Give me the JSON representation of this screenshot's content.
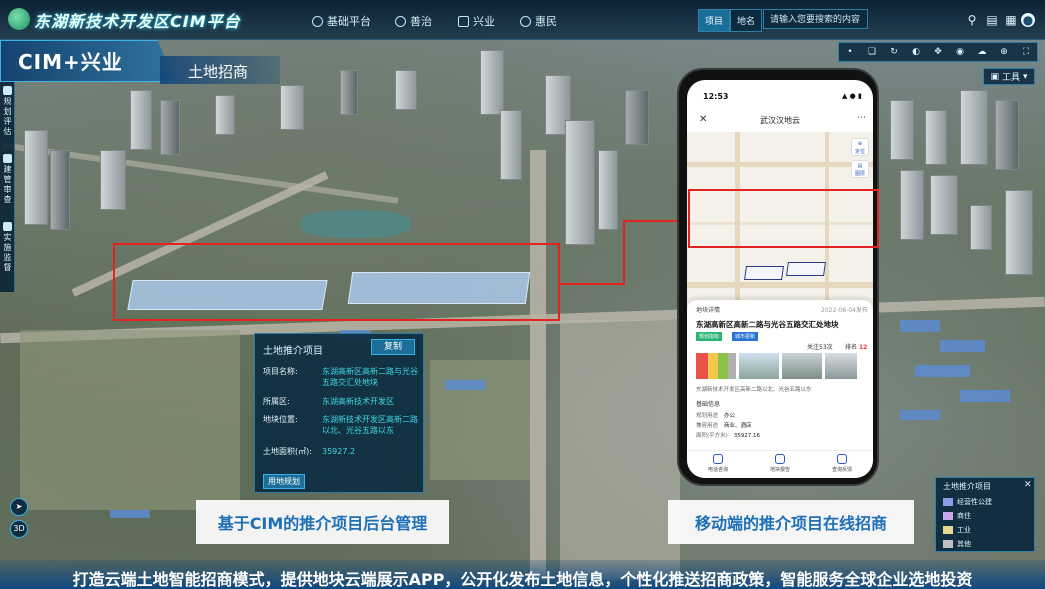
{
  "header": {
    "app_title": "东湖新技术开发区CIM平台",
    "nav": [
      {
        "label": "基础平台"
      },
      {
        "label": "善治"
      },
      {
        "label": "兴业"
      },
      {
        "label": "惠民"
      }
    ],
    "search_tabs": [
      {
        "label": "项目"
      },
      {
        "label": "地名"
      }
    ],
    "search_placeholder": "请输入您要搜索的内容",
    "icons": [
      "search-icon",
      "layers-icon",
      "grid-icon",
      "user-icon"
    ]
  },
  "module": {
    "title": "CIM+兴业",
    "subtitle": "土地招商"
  },
  "left_sidebar": {
    "items": [
      {
        "label": "规划评估"
      },
      {
        "label": "建管审查"
      },
      {
        "label": "实施监督"
      }
    ]
  },
  "right_toolbar": {
    "icons": [
      "point-icon",
      "measure-icon",
      "rotate-icon",
      "contrast-icon",
      "pan-icon",
      "eye-icon",
      "cloud-icon",
      "target-icon",
      "fullscreen-icon"
    ],
    "tools_label": "工具"
  },
  "info_panel": {
    "title": "土地推介项目",
    "copy_label": "复制",
    "rows": [
      {
        "label": "项目名称:",
        "value": "东湖高新区高新二路与光谷五路交汇处地块"
      },
      {
        "label": "所属区:",
        "value": "东湖高新技术开发区"
      },
      {
        "label": "地块位置:",
        "value": "东湖新技术开发区高新二路以北、光谷五路以东"
      },
      {
        "label": "土地面积(㎡):",
        "value": "35927.2"
      }
    ],
    "land_plan_label": "用地规划"
  },
  "captions": {
    "left": "基于CIM的推介项目后台管理",
    "right": "移动端的推介项目在线招商"
  },
  "banner": "打造云端土地智能招商模式，提供地块云端展示APP，公开化发布土地信息，个性化推送招商政策，智能服务全球企业选地投资",
  "legend": {
    "title": "土地推介项目",
    "items": [
      {
        "label": "经营性公建",
        "color": "#8c9ce8"
      },
      {
        "label": "商住",
        "color": "#c8a6e8"
      },
      {
        "label": "工业",
        "color": "#e8d88c"
      },
      {
        "label": "其他",
        "color": "#c0c0c0"
      }
    ]
  },
  "controls": {
    "mode_label": "3D"
  },
  "phone": {
    "time": "12:53",
    "title": "武汉汉地云",
    "map_buttons": [
      "定位",
      "图层"
    ],
    "card": {
      "label": "地块详情",
      "date": "2022-08-04发布",
      "title": "东湖高新区高新二路与光谷五路交汇处地块",
      "tags": [
        "规划指标",
        "城市更新"
      ],
      "follow": "关注53次",
      "rank_label": "排名",
      "rank_value": "12",
      "address": "东湖新技术开发区高新二路以北、光谷五路以东",
      "base_label": "基础信息",
      "kv": [
        {
          "k": "规划用途",
          "v": "办公"
        },
        {
          "k": "兼容用途",
          "v": "商业、酒店"
        },
        {
          "k": "面积(平方米)",
          "v": "35927.16"
        }
      ]
    },
    "bottom_nav": [
      {
        "label": "电话咨询"
      },
      {
        "label": "地块报告"
      },
      {
        "label": "查询反馈"
      }
    ]
  }
}
